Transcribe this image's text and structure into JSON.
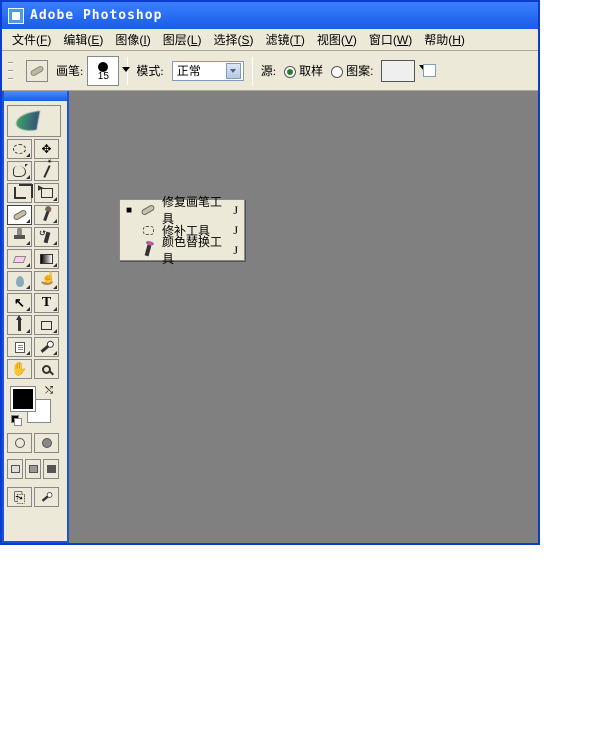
{
  "title": "Adobe Photoshop",
  "menu": [
    {
      "label": "文件",
      "accel": "F"
    },
    {
      "label": "编辑",
      "accel": "E"
    },
    {
      "label": "图像",
      "accel": "I"
    },
    {
      "label": "图层",
      "accel": "L"
    },
    {
      "label": "选择",
      "accel": "S"
    },
    {
      "label": "滤镜",
      "accel": "T"
    },
    {
      "label": "视图",
      "accel": "V"
    },
    {
      "label": "窗口",
      "accel": "W"
    },
    {
      "label": "帮助",
      "accel": "H"
    }
  ],
  "options": {
    "brush_label": "画笔",
    "brush_size": "15",
    "mode_label": "模式",
    "mode_value": "正常",
    "source_label": "源",
    "sample_label": "取样",
    "pattern_label": "图案"
  },
  "flyout": [
    {
      "label": "修复画笔工具",
      "key": "J",
      "icon": "heal",
      "selected": true
    },
    {
      "label": "修补工具",
      "key": "J",
      "icon": "patch",
      "selected": false
    },
    {
      "label": "颜色替换工具",
      "key": "J",
      "icon": "colrepl",
      "selected": false
    }
  ]
}
